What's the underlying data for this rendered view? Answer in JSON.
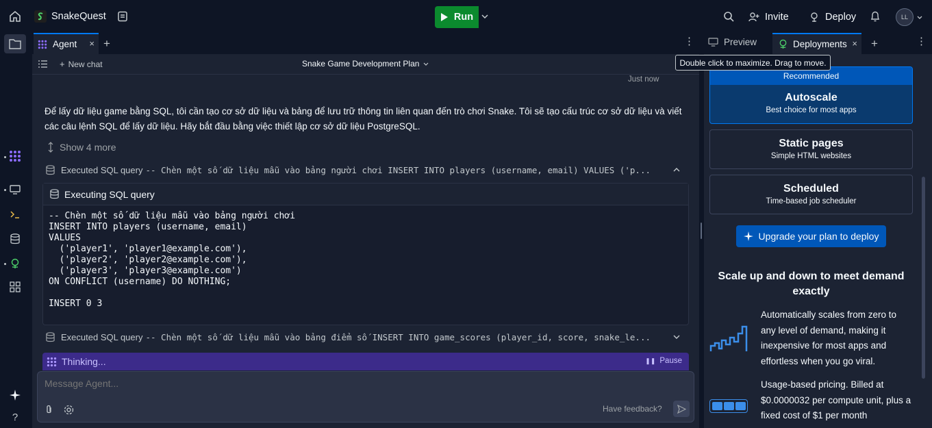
{
  "topbar": {
    "project_name": "SnakeQuest",
    "run_label": "Run",
    "invite_label": "Invite",
    "deploy_label": "Deploy",
    "avatar_initials": "LL"
  },
  "agent_panel": {
    "tab_label": "Agent",
    "new_chat_label": "New chat",
    "chat_title": "Snake Game Development Plan",
    "timestamp": "Just now",
    "message": "Để lấy dữ liệu game bằng SQL, tôi cần tạo cơ sở dữ liệu và bảng để lưu trữ thông tin liên quan đến trò chơi Snake. Tôi sẽ tạo cấu trúc cơ sở dữ liệu và viết các câu lệnh SQL để lấy dữ liệu. Hãy bắt đầu bằng việc thiết lập cơ sở dữ liệu PostgreSQL.",
    "show_more_label": "Show 4 more",
    "sql_row_1": {
      "label": "Executed SQL query",
      "query": "-- Chèn một số dữ liệu mẫu vào bảng người chơi INSERT INTO players (username, email) VALUES ('p..."
    },
    "code_block": {
      "header": "Executing SQL query",
      "code": "-- Chèn một số dữ liệu mẫu vào bảng người chơi\nINSERT INTO players (username, email)\nVALUES\n  ('player1', 'player1@example.com'),\n  ('player2', 'player2@example.com'),\n  ('player3', 'player3@example.com')\nON CONFLICT (username) DO NOTHING;\n\nINSERT 0 3"
    },
    "sql_row_2": {
      "label": "Executed SQL query",
      "query": "-- Chèn một số dữ liệu mẫu vào bảng điểm số INSERT INTO game_scores (player_id, score, snake_le..."
    },
    "thinking_label": "Thinking...",
    "pause_label": "Pause",
    "input_placeholder": "Message Agent...",
    "feedback_label": "Have feedback?"
  },
  "right_panel": {
    "tab_preview": "Preview",
    "tab_deployments": "Deployments",
    "tooltip": "Double click to maximize. Drag to move.",
    "recommended_badge": "Recommended",
    "options": [
      {
        "title": "Autoscale",
        "subtitle": "Best choice for most apps"
      },
      {
        "title": "Static pages",
        "subtitle": "Simple HTML websites"
      },
      {
        "title": "Scheduled",
        "subtitle": "Time-based job scheduler"
      }
    ],
    "upgrade_label": "Upgrade your plan to deploy",
    "heading": "Scale up and down to meet demand exactly",
    "feature_1": "Automatically scales from zero to any level of demand, making it inexpensive for most apps and effortless when you go viral.",
    "feature_2": "Usage-based pricing. Billed at $0.0000032 per compute unit, plus a fixed cost of $1 per month"
  },
  "colors": {
    "accent": "#0079f2",
    "run_green": "#0b8a2e",
    "thinking_purple": "#3c2b8a",
    "selected_card": "#0a3a6e"
  }
}
